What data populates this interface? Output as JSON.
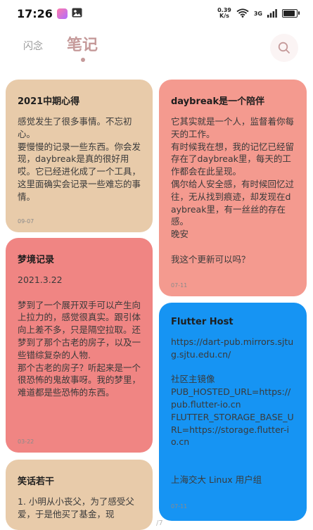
{
  "status": {
    "time": "17:26",
    "speed_value": "0.39",
    "speed_unit": "K/s",
    "net_label": "3G",
    "battery_level": 0.78
  },
  "header": {
    "tab_flash": "闪念",
    "tab_notes": "笔记"
  },
  "colors": {
    "tan": "#e8cbaa",
    "coral": "#f49a8f",
    "red": "#f08583",
    "blue": "#1694f3",
    "accent": "#c59a9a"
  },
  "notes": [
    {
      "title": "2021中期心得",
      "body": "感觉发生了很多事情。不忘初心。\n要慢慢的记录一些东西。你会发现，daybreak是真的很好用哎。它已经进化成了一个工具，这里面确实会记录一些难忘的事情。",
      "date": "09-07"
    },
    {
      "title": "daybreak是一个陪伴",
      "body": "它其实就是一个人，监督着你每天的工作。\n有时候我在想，我的记忆已经留存在了daybreak里，每天的工作都会在此呈现。\n偶尔给人安全感，有时候回忆过往，无从找到痕迹，却发现在daybreak里，有一丝丝的存在感。\n晚安\n\n我这个更新可以吗？",
      "date": "07-11"
    },
    {
      "title": "梦境记录",
      "body": "2021.3.22\n\n梦到了一个展开双手可以产生向上拉力的，感觉很真实。跟引体向上差不多，只是隔空拉取。还梦到了那个古老的房子，以及一些错综复杂的人物.\n那个古老的房子？听起来是一个很恐怖的鬼故事呀。我的梦里，难道都是些恐怖的东西。",
      "date": "03-22"
    },
    {
      "title": "Flutter Host",
      "body": "https://dart-pub.mirrors.sjtug.sjtu.edu.cn/\n\n社区主镜像\nPUB_HOSTED_URL=https://pub.flutter-io.cn\nFLUTTER_STORAGE_BASE_URL=https://storage.flutter-io.cn\n\n\n上海交大 Linux 用户组",
      "date": "07-11"
    },
    {
      "title": "笑话若干",
      "body": "1. 小明从小丧父，为了感受父爱，于是他买了基金，现",
      "date": ""
    }
  ],
  "page_indicator": "/7"
}
